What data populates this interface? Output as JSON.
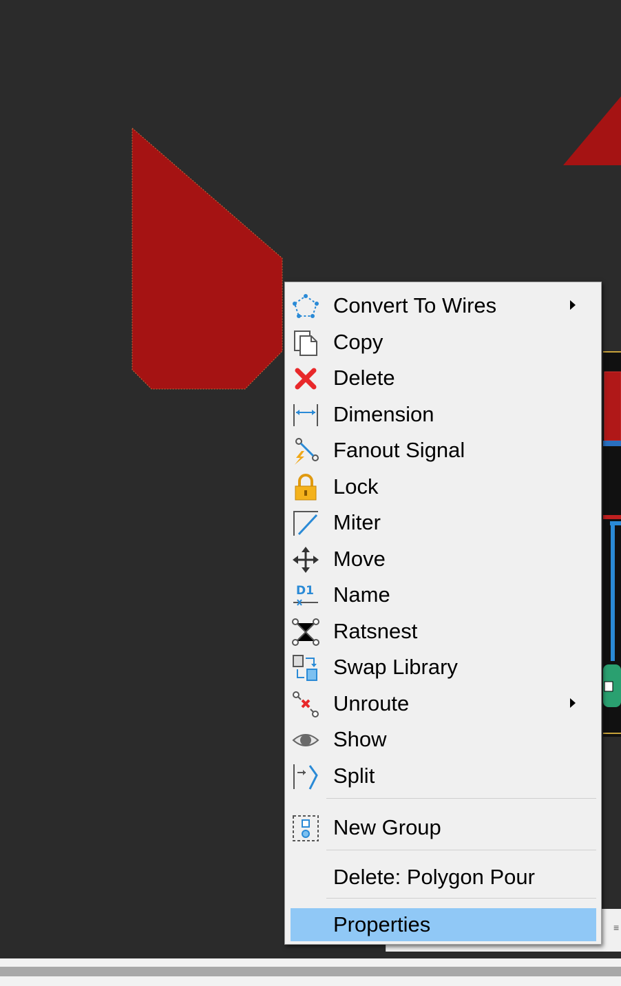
{
  "context_menu": {
    "items": [
      {
        "label": "Convert To Wires",
        "icon": "convert-to-wires-icon",
        "submenu": true
      },
      {
        "label": "Copy",
        "icon": "copy-icon",
        "submenu": false
      },
      {
        "label": "Delete",
        "icon": "delete-x-icon",
        "submenu": false
      },
      {
        "label": "Dimension",
        "icon": "dimension-icon",
        "submenu": false
      },
      {
        "label": "Fanout Signal",
        "icon": "fanout-signal-icon",
        "submenu": false
      },
      {
        "label": "Lock",
        "icon": "lock-icon",
        "submenu": false
      },
      {
        "label": "Miter",
        "icon": "miter-icon",
        "submenu": false
      },
      {
        "label": "Move",
        "icon": "move-icon",
        "submenu": false
      },
      {
        "label": "Name",
        "icon": "name-icon",
        "submenu": false
      },
      {
        "label": "Ratsnest",
        "icon": "ratsnest-icon",
        "submenu": false
      },
      {
        "label": "Swap Library",
        "icon": "swap-library-icon",
        "submenu": false
      },
      {
        "label": "Unroute",
        "icon": "unroute-icon",
        "submenu": true
      },
      {
        "label": "Show",
        "icon": "eye-icon",
        "submenu": false
      },
      {
        "label": "Split",
        "icon": "split-icon",
        "submenu": false
      }
    ],
    "group_item": {
      "label": "New Group",
      "icon": "new-group-icon"
    },
    "delete_polygon": {
      "label": "Delete: Polygon Pour"
    },
    "properties": {
      "label": "Properties",
      "highlighted": true
    }
  },
  "colors": {
    "canvas_bg": "#2b2b2b",
    "polygon_red": "#a51313",
    "menu_bg": "#f0f0f0",
    "highlight": "#90c8f6",
    "icon_blue": "#2a8ad6"
  }
}
